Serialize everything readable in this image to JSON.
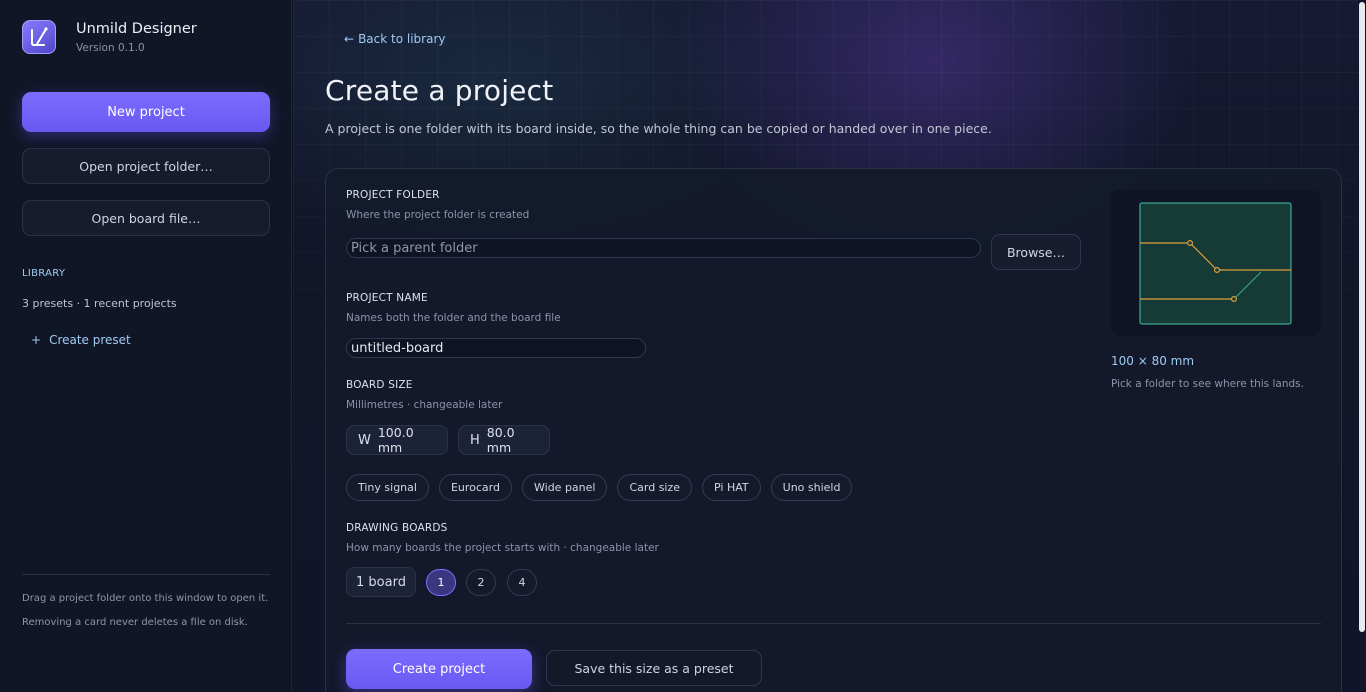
{
  "app": {
    "title": "Unmild Designer",
    "version": "Version 0.1.0"
  },
  "sidebar": {
    "new_project": "New project",
    "open_folder": "Open project folder…",
    "open_board": "Open board file…",
    "library_heading": "LIBRARY",
    "library_summary": "3 presets · 1 recent projects",
    "create_preset_plus": "+",
    "create_preset": "Create preset",
    "notes": [
      "Drag a project folder onto this window to open it.",
      "Removing a card never deletes a file on disk."
    ]
  },
  "main": {
    "back_arrow": "←",
    "back_link": "Back to library",
    "title": "Create a project",
    "subtitle": "A project is one folder with its board inside, so the whole thing can be copied or handed over in one piece."
  },
  "form": {
    "project_folder": {
      "label": "PROJECT FOLDER",
      "hint": "Where the project folder is created",
      "placeholder": "Pick a parent folder",
      "value": "",
      "browse": "Browse…"
    },
    "project_name": {
      "label": "PROJECT NAME",
      "hint": "Names both the folder and the board file",
      "value": "untitled-board"
    },
    "board_size": {
      "label": "BOARD SIZE",
      "hint": "Millimetres · changeable later",
      "width_letter": "W",
      "width_value": "100.0 mm",
      "height_letter": "H",
      "height_value": "80.0 mm",
      "presets": [
        "Tiny signal",
        "Eurocard",
        "Wide panel",
        "Card size",
        "Pi HAT",
        "Uno shield"
      ]
    },
    "drawing_boards": {
      "label": "DRAWING BOARDS",
      "hint": "How many boards the project starts with · changeable later",
      "badge": "1 board",
      "options": [
        "1",
        "2",
        "4"
      ],
      "selected": "1"
    },
    "create_button": "Create project",
    "save_preset_button": "Save this size as a preset"
  },
  "preview": {
    "size_label": "100 × 80 mm",
    "hint": "Pick a folder to see where this lands.",
    "colors": {
      "board_fill": "#163a35",
      "board_edge": "#3fc7a4",
      "trace": "#e0a03c",
      "trace_alt": "#3fa98c",
      "accent": "#7a6aff"
    }
  }
}
